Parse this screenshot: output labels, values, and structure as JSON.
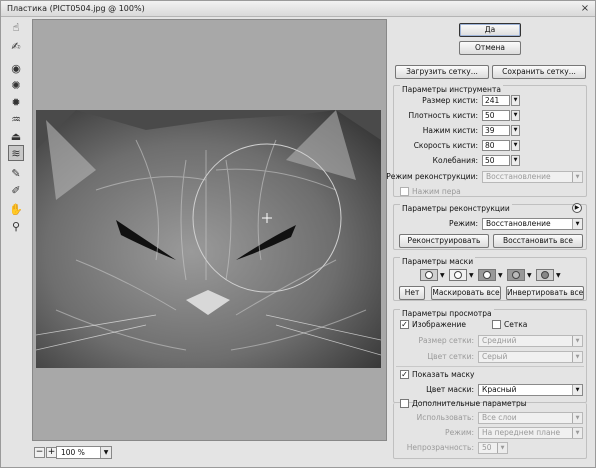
{
  "window": {
    "title": "Пластика (PICT0504.jpg @ 100%)",
    "close_glyph": "×"
  },
  "tools": [
    {
      "name": "forward-warp-tool",
      "glyph": "☝"
    },
    {
      "name": "reconstruct-tool",
      "glyph": "✍"
    },
    {
      "name": "twirl-clockwise-tool",
      "glyph": "◉"
    },
    {
      "name": "pucker-tool",
      "glyph": "✺"
    },
    {
      "name": "bloat-tool",
      "glyph": "✹"
    },
    {
      "name": "push-left-tool",
      "glyph": "♒"
    },
    {
      "name": "mirror-tool",
      "glyph": "⏏"
    },
    {
      "name": "turbulence-tool",
      "glyph": "≋"
    },
    {
      "name": "freeze-mask-tool",
      "glyph": "✎"
    },
    {
      "name": "thaw-mask-tool",
      "glyph": "✐"
    },
    {
      "name": "hand-tool",
      "glyph": "✋"
    },
    {
      "name": "zoom-tool",
      "glyph": "⚲"
    }
  ],
  "status": {
    "zoom_out": "−",
    "zoom_in": "+",
    "zoom_value": "100 %"
  },
  "buttons": {
    "ok": "Да",
    "cancel": "Отмена",
    "load_mesh": "Загрузить сетку...",
    "save_mesh": "Сохранить сетку..."
  },
  "tool_options": {
    "title": "Параметры инструмента",
    "brush_size_label": "Размер кисти:",
    "brush_size": "241",
    "brush_density_label": "Плотность кисти:",
    "brush_density": "50",
    "brush_pressure_label": "Нажим кисти:",
    "brush_pressure": "39",
    "brush_rate_label": "Скорость кисти:",
    "brush_rate": "80",
    "turbulent_jitter_label": "Колебания:",
    "turbulent_jitter": "50",
    "reconstruct_mode_label": "Режим реконструкции:",
    "reconstruct_mode": "Восстановление",
    "stylus_pressure_label": "Нажим пера"
  },
  "reconstruct_options": {
    "title": "Параметры реконструкции",
    "mode_label": "Режим:",
    "mode": "Восстановление",
    "reconstruct_button": "Реконструировать",
    "restore_all_button": "Восстановить все"
  },
  "mask_options": {
    "title": "Параметры маски",
    "none_button": "Нет",
    "mask_all_button": "Маскировать все",
    "invert_all_button": "Инвертировать все"
  },
  "view_options": {
    "title": "Параметры просмотра",
    "image_label": "Изображение",
    "mesh_label": "Сетка",
    "mesh_size_label": "Размер сетки:",
    "mesh_size": "Средний",
    "mesh_color_label": "Цвет сетки:",
    "mesh_color": "Серый",
    "show_mask_label": "Показать маску",
    "mask_color_label": "Цвет маски:",
    "mask_color": "Красный"
  },
  "backdrop": {
    "title": "Дополнительные параметры",
    "use_label": "Использовать:",
    "use": "Все слои",
    "mode_label": "Режим:",
    "mode": "На переднем плане",
    "opacity_label": "Непрозрачность:",
    "opacity": "50"
  }
}
